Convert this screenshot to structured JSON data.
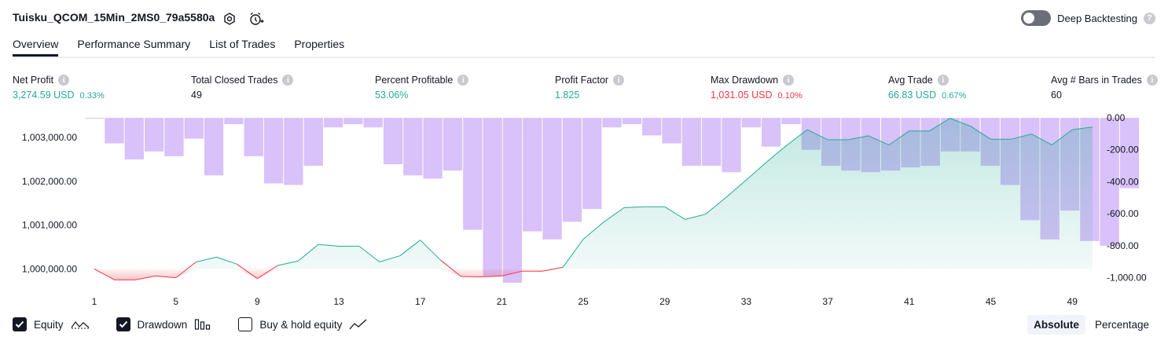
{
  "header": {
    "strategy_title": "Tuisku_QCOM_15Min_2MS0_79a5580a",
    "deep_backtesting_label": "Deep Backtesting",
    "deep_backtesting_help": "?"
  },
  "tabs": [
    {
      "label": "Overview",
      "active": true
    },
    {
      "label": "Performance Summary",
      "active": false
    },
    {
      "label": "List of Trades",
      "active": false
    },
    {
      "label": "Properties",
      "active": false
    }
  ],
  "metrics": [
    {
      "label": "Net Profit",
      "value": "3,274.59 USD",
      "pct": "0.33%",
      "color": "#22ab94"
    },
    {
      "label": "Total Closed Trades",
      "value": "49",
      "pct": "",
      "color": "#131722"
    },
    {
      "label": "Percent Profitable",
      "value": "53.06%",
      "pct": "",
      "color": "#22ab94"
    },
    {
      "label": "Profit Factor",
      "value": "1.825",
      "pct": "",
      "color": "#22ab94"
    },
    {
      "label": "Max Drawdown",
      "value": "1,031.05 USD",
      "pct": "0.10%",
      "color": "#f23645"
    },
    {
      "label": "Avg Trade",
      "value": "66.83 USD",
      "pct": "0.67%",
      "color": "#22ab94"
    },
    {
      "label": "Avg # Bars in Trades",
      "value": "60",
      "pct": "",
      "color": "#131722"
    }
  ],
  "chart_data": {
    "type": "line",
    "x_ticks": [
      "1",
      "5",
      "9",
      "13",
      "17",
      "21",
      "25",
      "29",
      "33",
      "37",
      "41",
      "45",
      "49"
    ],
    "left_axis_ticks": [
      "1,003,000.00",
      "1,002,000.00",
      "1,001,000.00",
      "1,000,000.00"
    ],
    "right_axis_ticks": [
      "0.00",
      "-200.00",
      "-400.00",
      "-600.00",
      "-800.00",
      "-1,000.00"
    ],
    "equity_baseline": 1000000,
    "left_ylim": [
      999650,
      1003450
    ],
    "right_ylim": [
      -1031,
      0
    ],
    "series": [
      {
        "name": "Equity",
        "color_positive": "#22ab94",
        "color_negative": "#f23645",
        "values": [
          1000000,
          999750,
          999750,
          999840,
          999800,
          1000160,
          1000270,
          1000110,
          999780,
          1000080,
          1000180,
          1000560,
          1000520,
          1000520,
          1000160,
          1000300,
          1000660,
          1000200,
          999830,
          999820,
          999840,
          999950,
          999950,
          1000040,
          1000680,
          1001070,
          1001400,
          1001420,
          1001420,
          1001130,
          1001250,
          1001630,
          1002030,
          1002440,
          1002830,
          1003180,
          1002950,
          1002950,
          1003040,
          1002830,
          1003150,
          1003150,
          1003440,
          1003260,
          1002960,
          1002960,
          1003080,
          1002830,
          1003180,
          1003240
        ]
      },
      {
        "name": "Drawdown",
        "color": "#c9a7f7",
        "values": [
          0,
          -160,
          -260,
          -210,
          -240,
          -130,
          -360,
          -40,
          -240,
          -410,
          -420,
          -300,
          -60,
          -40,
          -60,
          -290,
          -360,
          -380,
          -330,
          -700,
          -990,
          -1031,
          -710,
          -760,
          -650,
          -570,
          -60,
          -40,
          -110,
          -160,
          -300,
          -300,
          -340,
          -60,
          -180,
          -40,
          -200,
          -300,
          -330,
          -340,
          -330,
          -310,
          -300,
          -210,
          -210,
          -300,
          -420,
          -640,
          -760,
          -580,
          -770,
          -800,
          -440
        ]
      }
    ],
    "legend_placement": "bottom-left",
    "grid": false
  },
  "legend": {
    "items": [
      {
        "label": "Equity",
        "checked": true,
        "icon": "equity-line-icon"
      },
      {
        "label": "Drawdown",
        "checked": true,
        "icon": "drawdown-bars-icon"
      },
      {
        "label": "Buy & hold equity",
        "checked": false,
        "icon": "buy-hold-line-icon"
      }
    ]
  },
  "scale_toggle": {
    "options": [
      "Absolute",
      "Percentage"
    ],
    "selected": "Absolute"
  }
}
